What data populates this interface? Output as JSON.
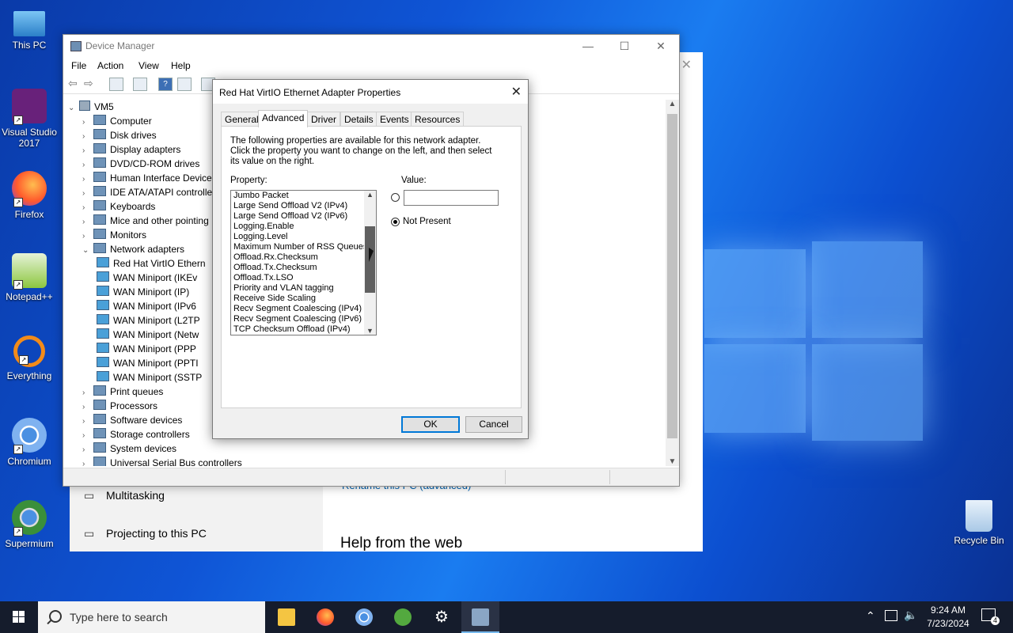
{
  "desktop": {
    "icons": [
      {
        "label": "This PC",
        "icon": "this-pc-icon"
      },
      {
        "label": "Visual Studio 2017",
        "icon": "visual-studio-icon"
      },
      {
        "label": "Firefox",
        "icon": "firefox-icon"
      },
      {
        "label": "Notepad++",
        "icon": "notepadpp-icon"
      },
      {
        "label": "Everything",
        "icon": "everything-icon"
      },
      {
        "label": "Chromium",
        "icon": "chromium-icon"
      },
      {
        "label": "Supermium",
        "icon": "supermium-icon"
      },
      {
        "label": "Recycle Bin",
        "icon": "recycle-bin-icon"
      }
    ]
  },
  "settings": {
    "items": [
      {
        "label": "Multitasking",
        "icon": "multitasking-icon"
      },
      {
        "label": "Projecting to this PC",
        "icon": "projecting-icon"
      }
    ],
    "link": "Rename this PC (advanced)",
    "help_heading": "Help from the web"
  },
  "device_manager": {
    "title": "Device Manager",
    "menu": [
      "File",
      "Action",
      "View",
      "Help"
    ],
    "tree": {
      "root": "VM5",
      "items": [
        {
          "label": "Computer",
          "expanded": false
        },
        {
          "label": "Disk drives",
          "expanded": false
        },
        {
          "label": "Display adapters",
          "expanded": false
        },
        {
          "label": "DVD/CD-ROM drives",
          "expanded": false
        },
        {
          "label": "Human Interface Device",
          "expanded": false
        },
        {
          "label": "IDE ATA/ATAPI controlle",
          "expanded": false
        },
        {
          "label": "Keyboards",
          "expanded": false
        },
        {
          "label": "Mice and other pointing",
          "expanded": false
        },
        {
          "label": "Monitors",
          "expanded": false
        },
        {
          "label": "Network adapters",
          "expanded": true
        },
        {
          "label": "Red Hat VirtIO Ethern",
          "child": true
        },
        {
          "label": "WAN Miniport (IKEv",
          "child": true
        },
        {
          "label": "WAN Miniport (IP)",
          "child": true
        },
        {
          "label": "WAN Miniport (IPv6",
          "child": true
        },
        {
          "label": "WAN Miniport (L2TP",
          "child": true
        },
        {
          "label": "WAN Miniport (Netw",
          "child": true
        },
        {
          "label": "WAN Miniport (PPP",
          "child": true
        },
        {
          "label": "WAN Miniport (PPTI",
          "child": true
        },
        {
          "label": "WAN Miniport (SSTP",
          "child": true
        },
        {
          "label": "Print queues",
          "expanded": false
        },
        {
          "label": "Processors",
          "expanded": false
        },
        {
          "label": "Software devices",
          "expanded": false
        },
        {
          "label": "Storage controllers",
          "expanded": false
        },
        {
          "label": "System devices",
          "expanded": false
        },
        {
          "label": "Universal Serial Bus controllers",
          "expanded": false
        }
      ]
    }
  },
  "dialog": {
    "title": "Red Hat VirtIO Ethernet Adapter Properties",
    "tabs": [
      "General",
      "Advanced",
      "Driver",
      "Details",
      "Events",
      "Resources"
    ],
    "active_tab": "Advanced",
    "description": "The following properties are available for this network adapter. Click the property you want to change on the left, and then select its value on the right.",
    "property_label": "Property:",
    "value_label": "Value:",
    "properties": [
      "Jumbo Packet",
      "Large Send Offload V2 (IPv4)",
      "Large Send Offload V2 (IPv6)",
      "Logging.Enable",
      "Logging.Level",
      "Maximum Number of RSS Queues",
      "Offload.Rx.Checksum",
      "Offload.Tx.Checksum",
      "Offload.Tx.LSO",
      "Priority and VLAN tagging",
      "Receive Side Scaling",
      "Recv Segment Coalescing (IPv4)",
      "Recv Segment Coalescing (IPv6)",
      "TCP Checksum Offload (IPv4)"
    ],
    "value_input": "",
    "not_present_label": "Not Present",
    "not_present_selected": true,
    "ok_label": "OK",
    "cancel_label": "Cancel"
  },
  "taskbar": {
    "search_placeholder": "Type here to search",
    "apps": [
      "file-explorer-icon",
      "firefox-icon",
      "chromium-icon",
      "utorrent-icon",
      "settings-gear-icon",
      "device-manager-icon"
    ],
    "time": "9:24 AM",
    "date": "7/23/2024",
    "notification_count": "4"
  },
  "colors": {
    "accent": "#0078d7",
    "desktop_blue": "#0f55d6",
    "taskbar": "#151c2c"
  }
}
